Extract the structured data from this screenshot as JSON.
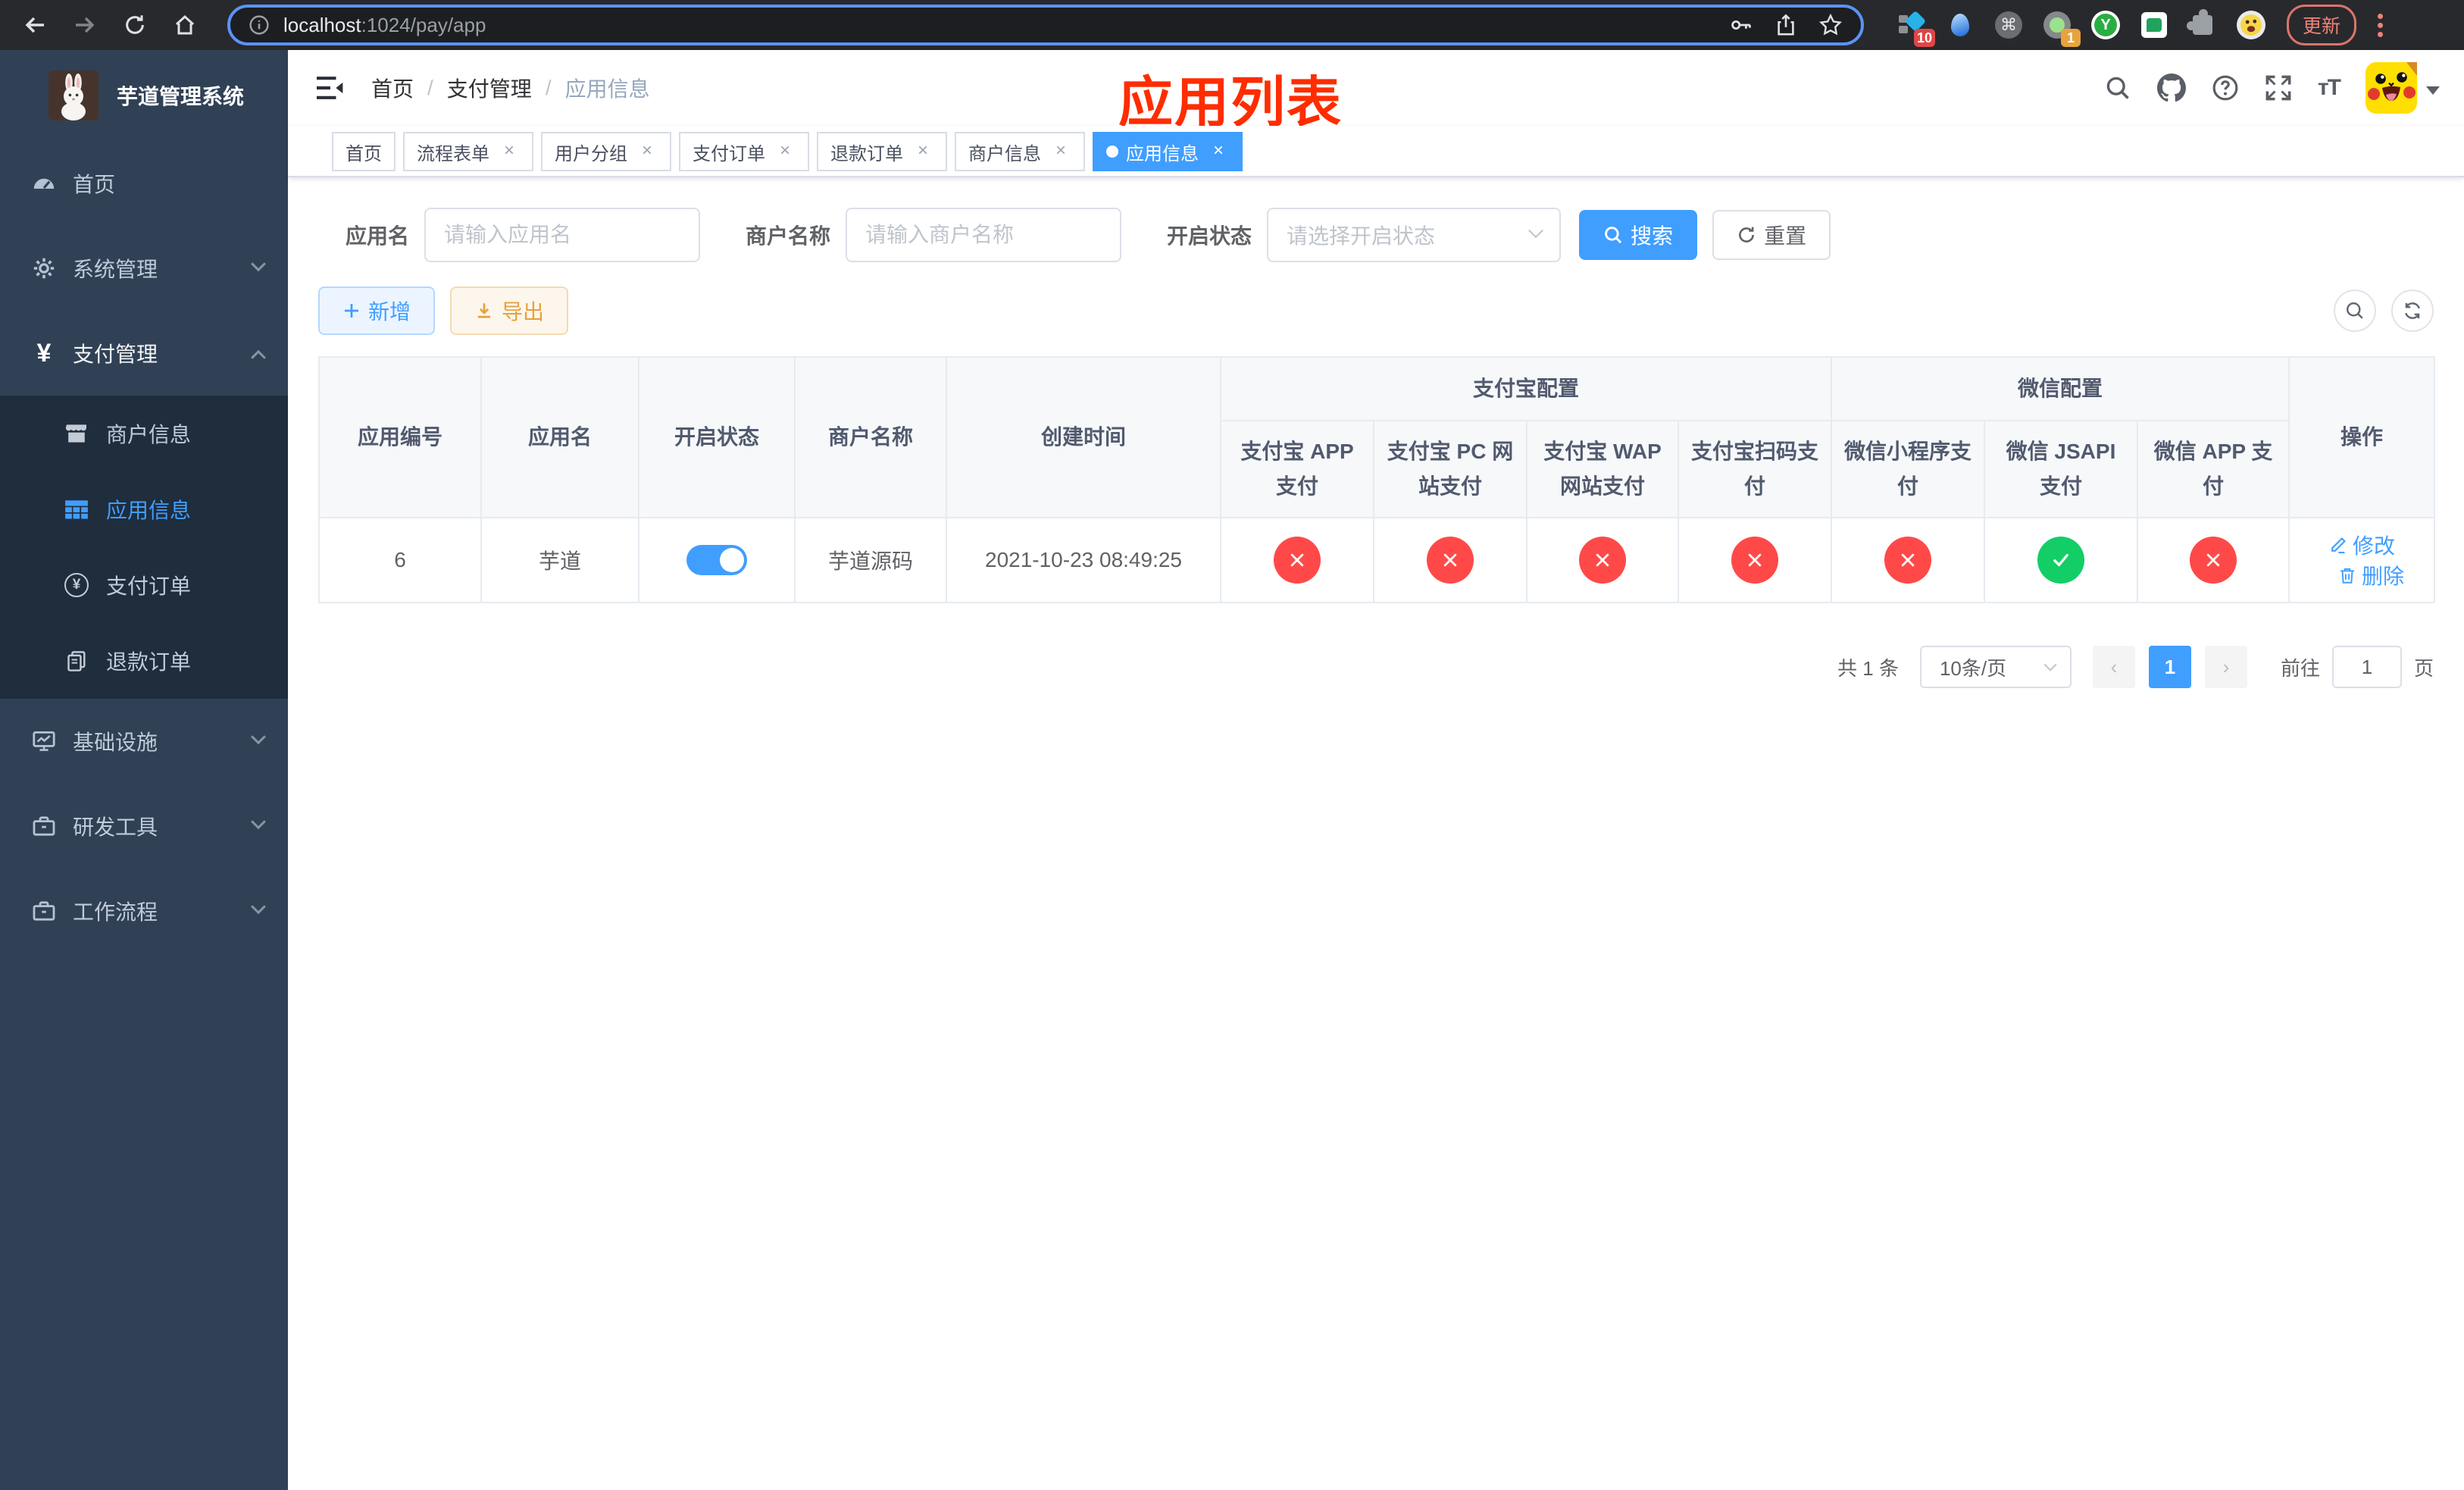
{
  "colors": {
    "primary": "#409eff",
    "danger": "#ff4949",
    "success": "#13ce66",
    "warning": "#e6a23c",
    "sidebar_bg": "#304156",
    "submenu_bg": "#1f2d3d",
    "annotation": "#fe2d00"
  },
  "browser": {
    "url_host": "localhost",
    "url_path": ":1024/pay/app",
    "ext_badge_1": "10",
    "ext_badge_2": "1",
    "ext_y_label": "Y",
    "update_label": "更新"
  },
  "sidebar": {
    "title": "芋道管理系统",
    "items": [
      {
        "label": "首页",
        "icon": "dashboard-icon"
      },
      {
        "label": "系统管理",
        "icon": "gear-icon",
        "expanded": false
      },
      {
        "label": "支付管理",
        "icon": "yen-icon",
        "expanded": true,
        "children": [
          {
            "label": "商户信息",
            "icon": "store-icon",
            "active": false
          },
          {
            "label": "应用信息",
            "icon": "grid-icon",
            "active": true
          },
          {
            "label": "支付订单",
            "icon": "yen-circle-icon",
            "active": false
          },
          {
            "label": "退款订单",
            "icon": "copy-icon",
            "active": false
          }
        ],
        "yen_glyph": "¥"
      },
      {
        "label": "基础设施",
        "icon": "monitor-icon",
        "expanded": false
      },
      {
        "label": "研发工具",
        "icon": "toolbox-icon",
        "expanded": false
      },
      {
        "label": "工作流程",
        "icon": "toolbox-icon",
        "expanded": false
      }
    ]
  },
  "header": {
    "breadcrumb": [
      "首页",
      "支付管理",
      "应用信息"
    ],
    "separator": "/",
    "annotation": "应用列表"
  },
  "tabs": [
    {
      "label": "首页",
      "closable": false,
      "active": false
    },
    {
      "label": "流程表单",
      "closable": true,
      "active": false
    },
    {
      "label": "用户分组",
      "closable": true,
      "active": false
    },
    {
      "label": "支付订单",
      "closable": true,
      "active": false
    },
    {
      "label": "退款订单",
      "closable": true,
      "active": false
    },
    {
      "label": "商户信息",
      "closable": true,
      "active": false
    },
    {
      "label": "应用信息",
      "closable": true,
      "active": true
    }
  ],
  "close_glyph": "×",
  "filters": {
    "app_name_label": "应用名",
    "app_name_placeholder": "请输入应用名",
    "merchant_label": "商户名称",
    "merchant_placeholder": "请输入商户名称",
    "status_label": "开启状态",
    "status_placeholder": "请选择开启状态",
    "search_label": "搜索",
    "reset_label": "重置"
  },
  "toolbar": {
    "add_label": "新增",
    "export_label": "导出"
  },
  "table": {
    "columns": [
      "应用编号",
      "应用名",
      "开启状态",
      "商户名称",
      "创建时间"
    ],
    "group_alipay": "支付宝配置",
    "group_wechat": "微信配置",
    "col_action": "操作",
    "sub_columns": [
      "支付宝 APP 支付",
      "支付宝 PC 网站支付",
      "支付宝 WAP 网站支付",
      "支付宝扫码支付",
      "微信小程序支付",
      "微信 JSAPI 支付",
      "微信 APP 支付"
    ],
    "rows": [
      {
        "id": "6",
        "name": "芋道",
        "enabled": true,
        "merchant": "芋道源码",
        "created": "2021-10-23 08:49:25",
        "statuses": [
          false,
          false,
          false,
          false,
          false,
          true,
          false
        ],
        "edit_label": "修改",
        "delete_label": "删除"
      }
    ]
  },
  "pagination": {
    "total": "共 1 条",
    "page_size": "10条/页",
    "prev_glyph": "‹",
    "next_glyph": "›",
    "current_page": "1",
    "goto_label": "前往",
    "goto_value": "1",
    "page_label": "页"
  }
}
